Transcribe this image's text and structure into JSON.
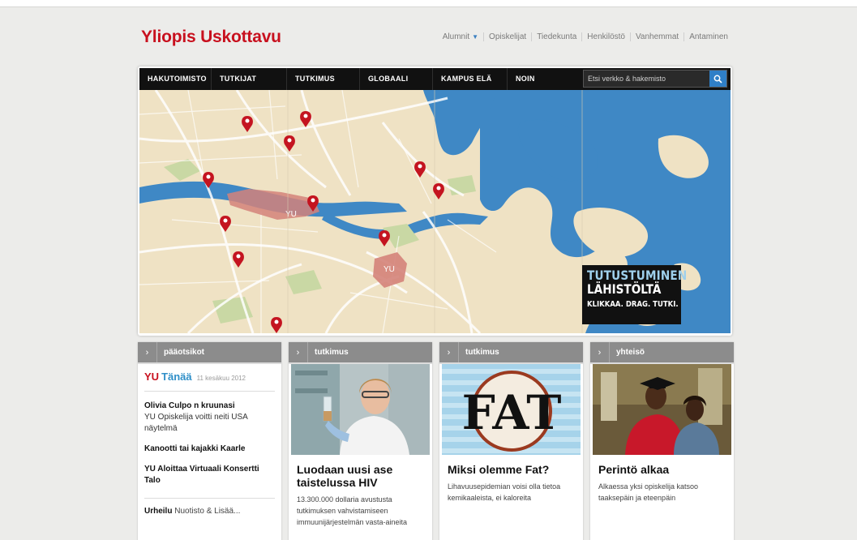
{
  "logo": "Yliopis Uskottavu",
  "util_nav": [
    {
      "label": "Alumnit",
      "has_dropdown": true
    },
    {
      "label": "Opiskelijat"
    },
    {
      "label": "Tiedekunta"
    },
    {
      "label": "Henkilöstö"
    },
    {
      "label": "Vanhemmat"
    },
    {
      "label": "Antaminen"
    }
  ],
  "main_nav": [
    "HAKUTOIMISTO",
    "TUTKIJAT",
    "TUTKIMUS",
    "GLOBAALI",
    "KAMPUS ELÄ",
    "NOIN"
  ],
  "search": {
    "placeholder": "Etsi verkko & hakemisto",
    "icon": "search-icon"
  },
  "map": {
    "campus_labels": [
      "YU",
      "YU"
    ],
    "promo": {
      "line1": "TUTUSTUMINEN",
      "line2": "LÄHISTÖLTÄ",
      "line3": "KLIKKAA. DRAG. TUTKI."
    }
  },
  "colors": {
    "brand_red": "#c8101e",
    "accent_blue": "#2f7fc7",
    "water": "#3f88c5",
    "land": "#efe2c4",
    "campus": "#d4837a"
  },
  "cards": {
    "news": {
      "header": "pääotsikot",
      "brand_yu": "YU",
      "brand_today": "Tänää",
      "date": "11 kesäkuu 2012",
      "items": [
        {
          "title": "Olivia Culpo n kruunasi",
          "text": "YU Opiskelija voitti neiti USA näytelmä"
        },
        {
          "title": "Kanootti tai kajakki Kaarle",
          "text": ""
        },
        {
          "title": "YU Aloittaa Virtuaali Konsertti Talo",
          "text": ""
        }
      ],
      "more_bold": "Urheilu",
      "more_text": "Nuotisto & Lisää..."
    },
    "research1": {
      "header": "tutkimus",
      "headline": "Luodaan uusi ase taistelussa HIV",
      "desc": "13.300.000 dollaria avustusta tutkimuksen vahvistamiseen immuunijärjestelmän vasta-aineita"
    },
    "research2": {
      "header": "tutkimus",
      "headline": "Miksi olemme Fat?",
      "desc": "Lihavuusepidemian voisi olla tietoa kemikaaleista, ei kaloreita",
      "image_text": "FAT"
    },
    "community": {
      "header": "yhteisö",
      "headline": "Perintö alkaa",
      "desc": "Alkaessa yksi opiskelija katsoo taaksepäin ja eteenpäin"
    }
  }
}
